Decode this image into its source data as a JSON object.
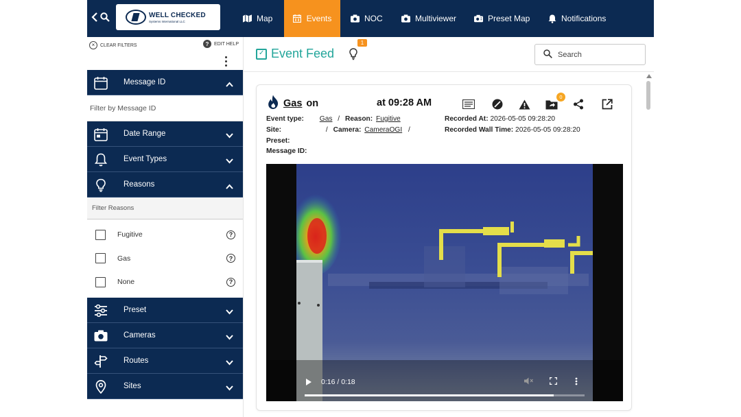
{
  "nav": {
    "items": [
      {
        "label": "Map",
        "icon": "map-icon"
      },
      {
        "label": "Events",
        "icon": "calendar-icon",
        "active": true
      },
      {
        "label": "NOC",
        "icon": "camera-icon"
      },
      {
        "label": "Multiviewer",
        "icon": "camera-icon"
      },
      {
        "label": "Preset Map",
        "icon": "camera-map-icon"
      },
      {
        "label": "Notifications",
        "icon": "bell-icon"
      }
    ],
    "active_color": "#f6921e",
    "bar_color": "#0c2a52"
  },
  "logo": {
    "title": "WELL CHECKED",
    "subtitle": "Systems International LLC"
  },
  "sidebar": {
    "clear_filters": "CLEAR FILTERS",
    "edit_help": "EDIT HELP",
    "sections": {
      "message_id": "Message ID",
      "date_range": "Date Range",
      "event_types": "Event Types",
      "reasons": "Reasons",
      "preset": "Preset",
      "cameras": "Cameras",
      "routes": "Routes",
      "sites": "Sites"
    },
    "message_id_placeholder": "Filter by Message ID",
    "reasons_placeholder": "Filter Reasons",
    "reasons": [
      "Fugitive",
      "Gas",
      "None"
    ]
  },
  "feed": {
    "title": "Event Feed",
    "badge": "1",
    "search_placeholder": "Search"
  },
  "event": {
    "gas_label": "Gas",
    "on_label": "on",
    "time_label": "at 09:28 AM",
    "folder_badge": "0",
    "event_type_label": "Event type:",
    "event_type_value": "Gas",
    "reason_label": "Reason:",
    "reason_value": "Fugitive",
    "site_label": "Site:",
    "camera_label": "Camera:",
    "camera_value": "CameraOGI",
    "preset_label": "Preset:",
    "message_id_label": "Message ID:",
    "recorded_at_label": "Recorded At:",
    "recorded_at_value": "2026-05-05 09:28:20",
    "recorded_wall_label": "Recorded Wall Time:",
    "recorded_wall_value": "2026-05-05 09:28:20",
    "separator": "/"
  },
  "video": {
    "time": "0:16 / 0:18",
    "progress": 0.889
  }
}
